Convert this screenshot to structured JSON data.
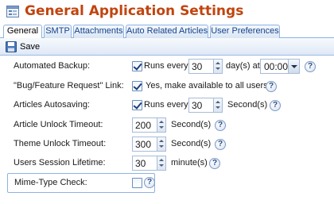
{
  "window": {
    "title": "General Application Settings"
  },
  "tabs": [
    {
      "label": "General",
      "active": true
    },
    {
      "label": "SMTP",
      "active": false
    },
    {
      "label": "Attachments",
      "active": false
    },
    {
      "label": "Auto Related Articles",
      "active": false
    },
    {
      "label": "User Preferences",
      "active": false
    }
  ],
  "toolbar": {
    "save_label": "Save"
  },
  "help_glyph": "?",
  "settings": {
    "automated_backup": {
      "label": "Automated Backup:",
      "checked": true,
      "runs_every_text": "Runs every",
      "interval_value": "30",
      "day_suffix": "day(s) at",
      "time_value": "00:00"
    },
    "bug_feature_link": {
      "label": "\"Bug/Feature Request\" Link:",
      "checked": true,
      "text": "Yes, make available to all users."
    },
    "articles_autosaving": {
      "label": "Articles Autosaving:",
      "checked": true,
      "runs_every_text": "Runs every",
      "interval_value": "30",
      "unit": "Second(s)"
    },
    "article_unlock_timeout": {
      "label": "Article Unlock Timeout:",
      "value": "200",
      "unit": "Second(s)"
    },
    "theme_unlock_timeout": {
      "label": "Theme Unlock Timeout:",
      "value": "300",
      "unit": "Second(s)"
    },
    "users_session_lifetime": {
      "label": "Users Session Lifetime:",
      "value": "30",
      "unit": "minute(s)"
    },
    "mime_type_check": {
      "label": "Mime-Type Check:",
      "checked": false
    }
  },
  "colors": {
    "title": "#c1440e",
    "tab_border": "#8db2e3",
    "toolbar_bg": "#dfe8f6"
  }
}
